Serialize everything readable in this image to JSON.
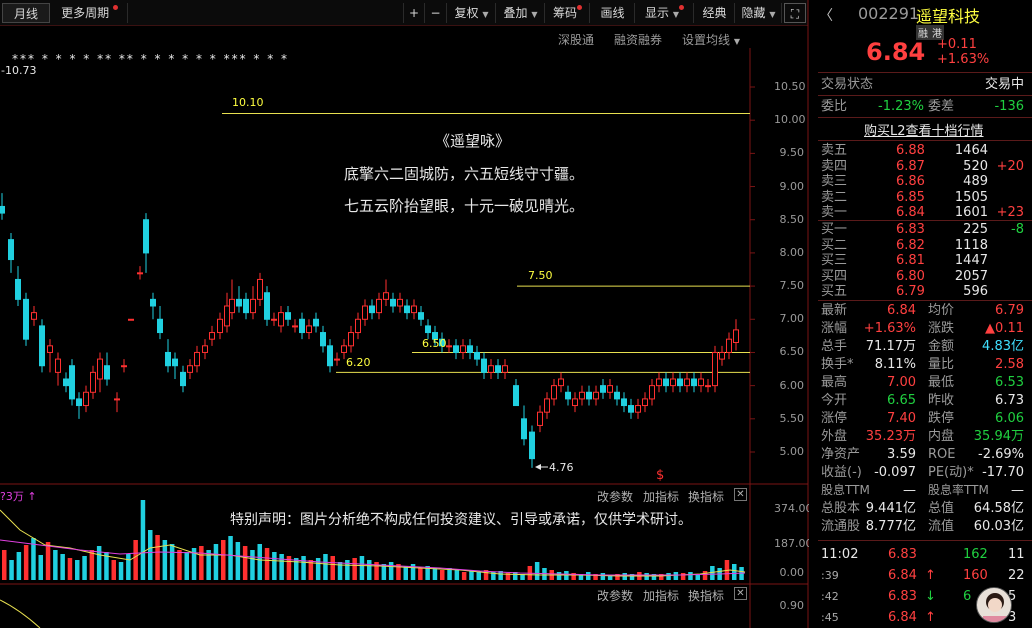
{
  "toolbar": {
    "period": "月线",
    "more_period": "更多周期",
    "plus": "+",
    "minus": "−",
    "fuquan": "复权",
    "overlay": "叠加",
    "chip": "筹码",
    "draw": "画线",
    "display": "显示",
    "classic": "经典",
    "hide": "隐藏",
    "fullscreen": "⛶"
  },
  "subtoolbar": {
    "shengutong": "深股通",
    "margin": "融资融券",
    "set_ma": "设置均线"
  },
  "chart": {
    "top_left_value": "-10.73",
    "h_lines": {
      "l1010": "10.10",
      "l750": "7.50",
      "l650": "6.50",
      "l620": "6.20"
    },
    "low_label": "4.76",
    "dollar": "$",
    "poem_title": "《遥望咏》",
    "poem_line1": "底擎六二固城防，六五短线守寸疆。",
    "poem_line2": "七五云阶抬望眼，十元一破见晴光。",
    "price_axis": [
      "10.50",
      "10.00",
      "9.50",
      "9.00",
      "8.50",
      "8.00",
      "7.50",
      "7.00",
      "6.50",
      "6.00",
      "5.50",
      "5.00"
    ],
    "marks_text": "*** * * * * ** ** * * * * * * *** * * *"
  },
  "volume": {
    "left_label": "?3万",
    "arrow": "↑",
    "change_param": "改参数",
    "add_indicator": "加指标",
    "switch_indicator": "换指标",
    "close": "✕",
    "disclaimer": "特别声明：图片分析绝不构成任何投资建议、引导或承诺，仅供学术研讨。",
    "axis": [
      "374.00",
      "187.00",
      "0.00"
    ]
  },
  "macd": {
    "change_param": "改参数",
    "add_indicator": "加指标",
    "switch_indicator": "换指标",
    "close": "✕",
    "axis": "0.90"
  },
  "quote": {
    "code": "002291",
    "name": "遥望科技",
    "badge1": "融",
    "badge2": "港",
    "price": "6.84",
    "chg": "+0.11",
    "pct": "+1.63%",
    "status_label": "交易状态",
    "status": "交易中",
    "weibi_label": "委比",
    "weibi": "-1.23%",
    "weicha_label": "委差",
    "weicha": "-136",
    "l2": "购买L2查看十档行情",
    "asks": [
      {
        "l": "卖五",
        "p": "6.88",
        "v": "1464",
        "c": ""
      },
      {
        "l": "卖四",
        "p": "6.87",
        "v": "520",
        "c": "+20"
      },
      {
        "l": "卖三",
        "p": "6.86",
        "v": "489",
        "c": ""
      },
      {
        "l": "卖二",
        "p": "6.85",
        "v": "1505",
        "c": ""
      },
      {
        "l": "卖一",
        "p": "6.84",
        "v": "1601",
        "c": "+23"
      }
    ],
    "bids": [
      {
        "l": "买一",
        "p": "6.83",
        "v": "225",
        "c": "-8"
      },
      {
        "l": "买二",
        "p": "6.82",
        "v": "1118",
        "c": ""
      },
      {
        "l": "买三",
        "p": "6.81",
        "v": "1447",
        "c": ""
      },
      {
        "l": "买四",
        "p": "6.80",
        "v": "2057",
        "c": ""
      },
      {
        "l": "买五",
        "p": "6.79",
        "v": "596",
        "c": ""
      }
    ],
    "stats": [
      {
        "a": "最新",
        "av": "6.84",
        "ac": "red",
        "b": "均价",
        "bv": "6.79",
        "bc": "red"
      },
      {
        "a": "涨幅",
        "av": "+1.63%",
        "ac": "red",
        "b": "涨跌",
        "bv": "▲0.11",
        "bc": "red"
      },
      {
        "a": "总手",
        "av": "71.17万",
        "ac": "wht",
        "b": "金额",
        "bv": "4.83亿",
        "bc": "cyan"
      },
      {
        "a": "换手*",
        "av": "8.11%",
        "ac": "wht",
        "b": "量比",
        "bv": "2.58",
        "bc": "red"
      },
      {
        "a": "最高",
        "av": "7.00",
        "ac": "red",
        "b": "最低",
        "bv": "6.53",
        "bc": "grn"
      },
      {
        "a": "今开",
        "av": "6.65",
        "ac": "grn",
        "b": "昨收",
        "bv": "6.73",
        "bc": "wht"
      },
      {
        "a": "涨停",
        "av": "7.40",
        "ac": "red",
        "b": "跌停",
        "bv": "6.06",
        "bc": "grn"
      },
      {
        "a": "外盘",
        "av": "35.23万",
        "ac": "red",
        "b": "内盘",
        "bv": "35.94万",
        "bc": "grn"
      },
      {
        "a": "净资产",
        "av": "3.59",
        "ac": "wht",
        "b": "ROE",
        "bv": "-2.69%",
        "bc": "wht"
      },
      {
        "a": "收益(-)",
        "av": "-0.097",
        "ac": "wht",
        "b": "PE(动)*",
        "bv": "-17.70",
        "bc": "wht"
      },
      {
        "a": "股息TTM",
        "av": "—",
        "ac": "wht",
        "b": "股息率TTM",
        "bv": "—",
        "bc": "wht"
      },
      {
        "a": "总股本",
        "av": "9.441亿",
        "ac": "wht",
        "b": "总值",
        "bv": "64.58亿",
        "bc": "wht"
      },
      {
        "a": "流通股",
        "av": "8.777亿",
        "ac": "wht",
        "b": "流值",
        "bv": "60.03亿",
        "bc": "wht"
      }
    ],
    "ticks": [
      {
        "t": "11:02",
        "p": "6.83",
        "pc": "red",
        "v": "162",
        "vc": "grn",
        "n": "11",
        "arr": ""
      },
      {
        "t": ":39",
        "p": "6.84",
        "pc": "red",
        "v": "160",
        "vc": "red",
        "n": "22",
        "arr": "↑"
      },
      {
        "t": ":42",
        "p": "6.83",
        "pc": "red",
        "v": "6",
        "vc": "grn",
        "n": "5",
        "arr": "↓"
      },
      {
        "t": ":45",
        "p": "6.84",
        "pc": "red",
        "v": "",
        "vc": "red",
        "n": "3",
        "arr": "↑"
      }
    ]
  }
}
